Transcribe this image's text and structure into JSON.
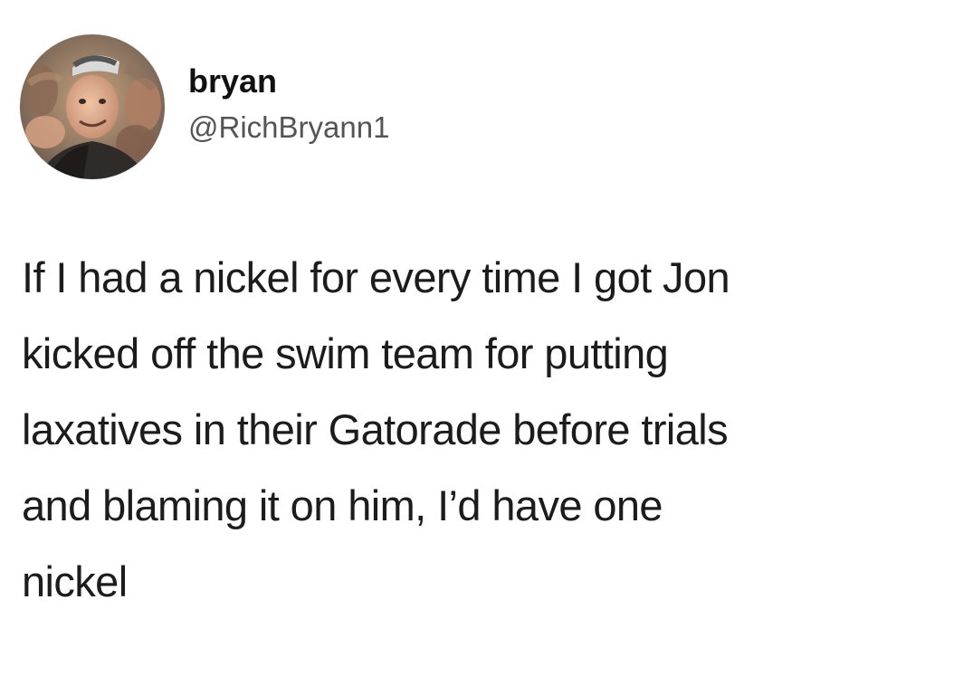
{
  "tweet": {
    "author": {
      "display_name": "bryan",
      "handle": "@RichBryann1"
    },
    "text": "If I had a nickel for every time I got Jon\nkicked off the swim team for putting\nlaxatives in their Gatorade before trials\nand blaming it on him, I’d have one\nnickel"
  },
  "colors": {
    "background": "#ffffff",
    "display_name": "#111111",
    "handle": "#545454",
    "body_text": "#1c1c1c"
  }
}
